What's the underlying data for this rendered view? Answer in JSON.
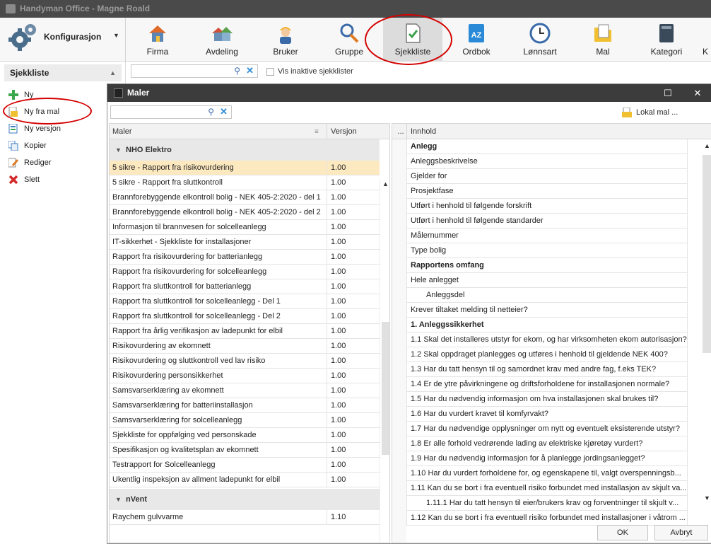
{
  "window": {
    "title": "Handyman Office - Magne Roald"
  },
  "ribbon": {
    "config_label": "Konfigurasjon",
    "items": [
      {
        "label": "Firma",
        "icon": "house-icon"
      },
      {
        "label": "Avdeling",
        "icon": "houses-icon"
      },
      {
        "label": "Bruker",
        "icon": "worker-icon"
      },
      {
        "label": "Gruppe",
        "icon": "group-tools-icon"
      },
      {
        "label": "Sjekkliste",
        "icon": "checklist-icon"
      },
      {
        "label": "Ordbok",
        "icon": "dictionary-icon"
      },
      {
        "label": "Lønnsart",
        "icon": "clock-icon"
      },
      {
        "label": "Mal",
        "icon": "template-folder-icon"
      },
      {
        "label": "Kategori",
        "icon": "category-book-icon"
      }
    ],
    "active": "Sjekkliste"
  },
  "left_panel": {
    "header": "Sjekkliste",
    "actions": [
      {
        "label": "Ny",
        "icon": "plus-icon"
      },
      {
        "label": "Ny fra mal",
        "icon": "new-from-template-icon"
      },
      {
        "label": "Ny versjon",
        "icon": "new-version-icon"
      },
      {
        "label": "Kopier",
        "icon": "copy-icon"
      },
      {
        "label": "Rediger",
        "icon": "edit-icon"
      },
      {
        "label": "Slett",
        "icon": "delete-icon"
      }
    ]
  },
  "toolbar": {
    "search_value": "",
    "show_inactive_label": "Vis inaktive sjekklister"
  },
  "dialog": {
    "title": "Maler",
    "search_value": "",
    "local_template_label": "Lokal mal ...",
    "templates_grid": {
      "columns": [
        "Maler",
        "Versjon"
      ],
      "groups": [
        {
          "name": "NHO Elektro",
          "rows": [
            {
              "name": "5 sikre - Rapport fra risikovurdering",
              "version": "1.00",
              "selected": true
            },
            {
              "name": "5 sikre - Rapport fra sluttkontroll",
              "version": "1.00"
            },
            {
              "name": "Brannforebyggende elkontroll bolig - NEK 405-2:2020 - del 1",
              "version": "1.00"
            },
            {
              "name": "Brannforebyggende elkontroll bolig - NEK 405-2:2020 - del 2",
              "version": "1.00"
            },
            {
              "name": "Informasjon til brannvesen for solcelleanlegg",
              "version": "1.00"
            },
            {
              "name": "IT-sikkerhet - Sjekkliste for installasjoner",
              "version": "1.00"
            },
            {
              "name": "Rapport fra risikovurdering for batterianlegg",
              "version": "1.00"
            },
            {
              "name": "Rapport fra risikovurdering for solcelleanlegg",
              "version": "1.00"
            },
            {
              "name": "Rapport fra sluttkontroll for batterianlegg",
              "version": "1.00"
            },
            {
              "name": "Rapport fra sluttkontroll for solcelleanlegg - Del 1",
              "version": "1.00"
            },
            {
              "name": "Rapport fra sluttkontroll for solcelleanlegg - Del 2",
              "version": "1.00"
            },
            {
              "name": "Rapport fra årlig verifikasjon av ladepunkt for elbil",
              "version": "1.00"
            },
            {
              "name": "Risikovurdering av ekomnett",
              "version": "1.00"
            },
            {
              "name": "Risikovurdering og sluttkontroll ved lav risiko",
              "version": "1.00"
            },
            {
              "name": "Risikovurdering personsikkerhet",
              "version": "1.00"
            },
            {
              "name": "Samsvarserklæring av ekomnett",
              "version": "1.00"
            },
            {
              "name": "Samsvarserklæring for batteriinstallasjon",
              "version": "1.00"
            },
            {
              "name": "Samsvarserklæring for solcelleanlegg",
              "version": "1.00"
            },
            {
              "name": "Sjekkliste for oppfølging ved personskade",
              "version": "1.00"
            },
            {
              "name": "Spesifikasjon og kvalitetsplan av ekomnett",
              "version": "1.00"
            },
            {
              "name": "Testrapport for Solcelleanlegg",
              "version": "1.00"
            },
            {
              "name": "Ukentlig inspeksjon av allment ladepunkt for elbil",
              "version": "1.00"
            }
          ]
        },
        {
          "name": "nVent",
          "rows": [
            {
              "name": "Raychem gulvvarme",
              "version": "1.10"
            }
          ]
        }
      ]
    },
    "content_grid": {
      "columns": [
        "...",
        "Innhold"
      ],
      "rows": [
        {
          "text": "Anlegg",
          "bold": true
        },
        {
          "text": "Anleggsbeskrivelse"
        },
        {
          "text": "Gjelder for"
        },
        {
          "text": "Prosjektfase"
        },
        {
          "text": "Utført i henhold til følgende forskrift"
        },
        {
          "text": "Utført i henhold til følgende standarder"
        },
        {
          "text": "Målernummer"
        },
        {
          "text": "Type bolig"
        },
        {
          "text": "Rapportens omfang",
          "bold": true
        },
        {
          "text": "Hele anlegget"
        },
        {
          "text": "Anleggsdel",
          "indent": 1
        },
        {
          "text": "Krever tiltaket melding til netteier?"
        },
        {
          "text": "1. Anleggssikkerhet",
          "bold": true
        },
        {
          "text": "1.1 Skal det installeres utstyr for ekom, og har virksomheten ekom autorisasjon?"
        },
        {
          "text": "1.2 Skal oppdraget planlegges og utføres i henhold til gjeldende NEK 400?"
        },
        {
          "text": "1.3 Har du tatt hensyn til og samordnet krav med andre fag, f.eks TEK?"
        },
        {
          "text": "1.4 Er de ytre påvirkningene og driftsforholdene for installasjonen normale?"
        },
        {
          "text": "1.5 Har du nødvendig informasjon om hva installasjonen skal brukes til?"
        },
        {
          "text": "1.6 Har du vurdert kravet til komfyrvakt?"
        },
        {
          "text": "1.7 Har du nødvendige opplysninger om nytt og eventuelt eksisterende utstyr?"
        },
        {
          "text": "1.8 Er alle forhold vedrørende lading av elektriske kjøretøy vurdert?"
        },
        {
          "text": "1.9 Har du nødvendig informasjon for å planlegge jordingsanlegget?"
        },
        {
          "text": "1.10 Har du vurdert forholdene for, og egenskapene til, valgt overspenningsb..."
        },
        {
          "text": "1.11 Kan du se bort i fra eventuell risiko forbundet med installasjon av skjult va..."
        },
        {
          "text": "1.11.1 Har du tatt hensyn til eier/brukers krav og forventninger til skjult v...",
          "indent": 1
        },
        {
          "text": "1.12 Kan du se bort i fra eventuell risiko forbundet med installasjoner i våtrom ..."
        }
      ]
    },
    "buttons": {
      "ok": "OK",
      "cancel": "Avbryt"
    }
  },
  "colors": {
    "highlight_ring": "#d40000",
    "selected_row": "#fde9c0",
    "titlebar": "#4a4a4a",
    "dialog_titlebar": "#3c3c3c"
  }
}
